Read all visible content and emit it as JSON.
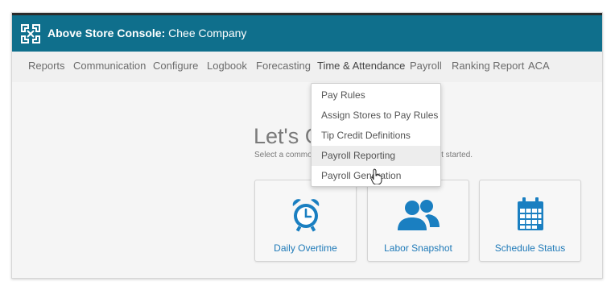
{
  "header": {
    "brand_bold": "Above Store Console:",
    "company": "Chee Company"
  },
  "nav": {
    "items": [
      {
        "label": "Reports"
      },
      {
        "label": "Communication"
      },
      {
        "label": "Configure"
      },
      {
        "label": "Logbook"
      },
      {
        "label": "Forecasting"
      },
      {
        "label": "Time & Attendance"
      },
      {
        "label": "Payroll"
      },
      {
        "label": "Ranking Report"
      },
      {
        "label": "ACA"
      }
    ],
    "active": "Time & Attendance"
  },
  "dropdown": {
    "items": [
      {
        "label": "Pay Rules"
      },
      {
        "label": "Assign Stores to Pay Rules"
      },
      {
        "label": "Tip Credit Definitions"
      },
      {
        "label": "Payroll Reporting"
      },
      {
        "label": "Payroll Generation"
      }
    ],
    "hovered": "Payroll Reporting"
  },
  "main": {
    "title": "Let's G",
    "subtitle_start": "Select a commo",
    "subtitle_end": "get started."
  },
  "cards": [
    {
      "label": "Daily Overtime",
      "icon": "alarm-clock-icon"
    },
    {
      "label": "Labor Snapshot",
      "icon": "users-icon"
    },
    {
      "label": "Schedule Status",
      "icon": "calendar-icon"
    }
  ],
  "colors": {
    "header_bg": "#0f6f8c",
    "accent_blue": "#1f7ab8",
    "icon_blue": "#1a7fc1"
  }
}
